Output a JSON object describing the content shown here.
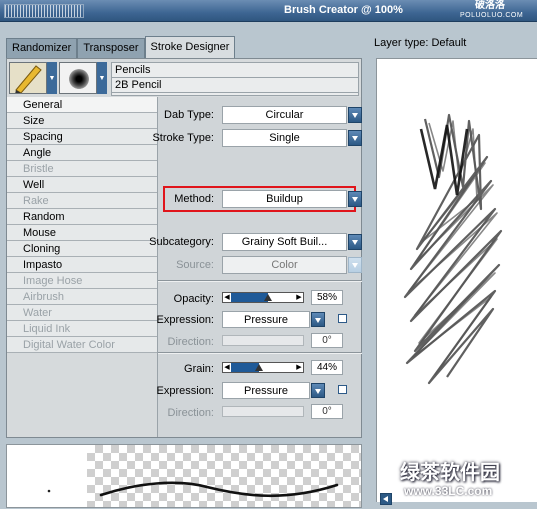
{
  "window": {
    "title": "Brush Creator @ 100%",
    "watermark_top": "破洛洛",
    "watermark_top_url": "POLUOLUO.COM"
  },
  "tabs": [
    {
      "label": "Randomizer",
      "active": false
    },
    {
      "label": "Transposer",
      "active": false
    },
    {
      "label": "Stroke Designer",
      "active": true
    }
  ],
  "brush": {
    "category": "Pencils",
    "variant": "2B Pencil"
  },
  "categories": [
    {
      "label": "General",
      "state": "selected"
    },
    {
      "label": "Size",
      "state": "normal"
    },
    {
      "label": "Spacing",
      "state": "normal"
    },
    {
      "label": "Angle",
      "state": "normal"
    },
    {
      "label": "Bristle",
      "state": "disabled"
    },
    {
      "label": "Well",
      "state": "normal"
    },
    {
      "label": "Rake",
      "state": "disabled"
    },
    {
      "label": "Random",
      "state": "normal"
    },
    {
      "label": "Mouse",
      "state": "normal"
    },
    {
      "label": "Cloning",
      "state": "normal"
    },
    {
      "label": "Impasto",
      "state": "normal"
    },
    {
      "label": "Image Hose",
      "state": "disabled"
    },
    {
      "label": "Airbrush",
      "state": "disabled"
    },
    {
      "label": "Water",
      "state": "disabled"
    },
    {
      "label": "Liquid Ink",
      "state": "disabled"
    },
    {
      "label": "Digital Water Color",
      "state": "disabled"
    }
  ],
  "general": {
    "dab_type": {
      "label": "Dab Type:",
      "value": "Circular"
    },
    "stroke_type": {
      "label": "Stroke Type:",
      "value": "Single"
    },
    "method": {
      "label": "Method:",
      "value": "Buildup"
    },
    "subcategory": {
      "label": "Subcategory:",
      "value": "Grainy Soft Buil..."
    },
    "source": {
      "label": "Source:",
      "value": "Color"
    },
    "opacity": {
      "label": "Opacity:",
      "value": "58%",
      "level": 0.58
    },
    "opacity_expression": {
      "label": "Expression:",
      "value": "Pressure"
    },
    "opacity_direction": {
      "label": "Direction:",
      "value": "0°"
    },
    "grain": {
      "label": "Grain:",
      "value": "44%",
      "level": 0.44
    },
    "grain_expression": {
      "label": "Expression:",
      "value": "Pressure"
    },
    "grain_direction": {
      "label": "Direction:",
      "value": "0°"
    }
  },
  "preview_panel": {
    "layer_type_label": "Layer type: Default"
  },
  "watermark_bottom": {
    "text": "绿茶软件园",
    "url": "www.33LC.com"
  },
  "colors": {
    "accent": "#2c5985",
    "highlight_box": "#e0151b",
    "titlebar": "#3e6693"
  }
}
